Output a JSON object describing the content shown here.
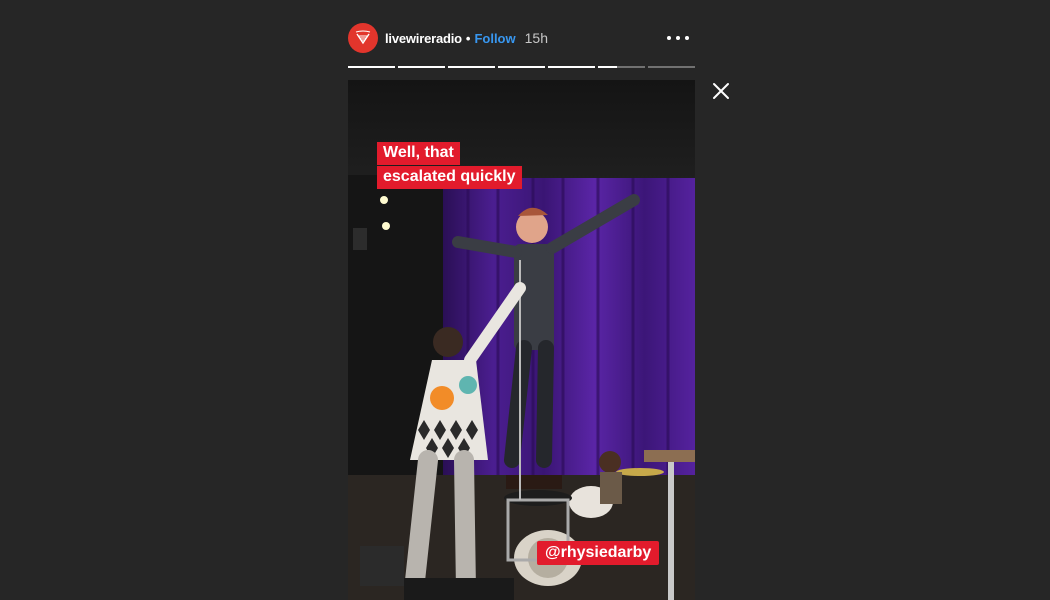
{
  "header": {
    "username": "livewireradio",
    "separator": "•",
    "follow_label": "Follow",
    "time": "15h"
  },
  "progress": {
    "segments": [
      1,
      1,
      1,
      1,
      1,
      0.4,
      0
    ]
  },
  "story": {
    "caption_line1": "Well, that",
    "caption_line2": "escalated quickly",
    "mention": "@rhysiedarby"
  },
  "colors": {
    "background": "#262626",
    "brand": "#e2352c",
    "follow": "#3897f0",
    "sticker": "#e21b2c",
    "curtain": "#4a1a8a"
  },
  "icons": {
    "avatar": "livewire-logo-icon",
    "more": "more-options-icon",
    "close": "close-icon"
  }
}
